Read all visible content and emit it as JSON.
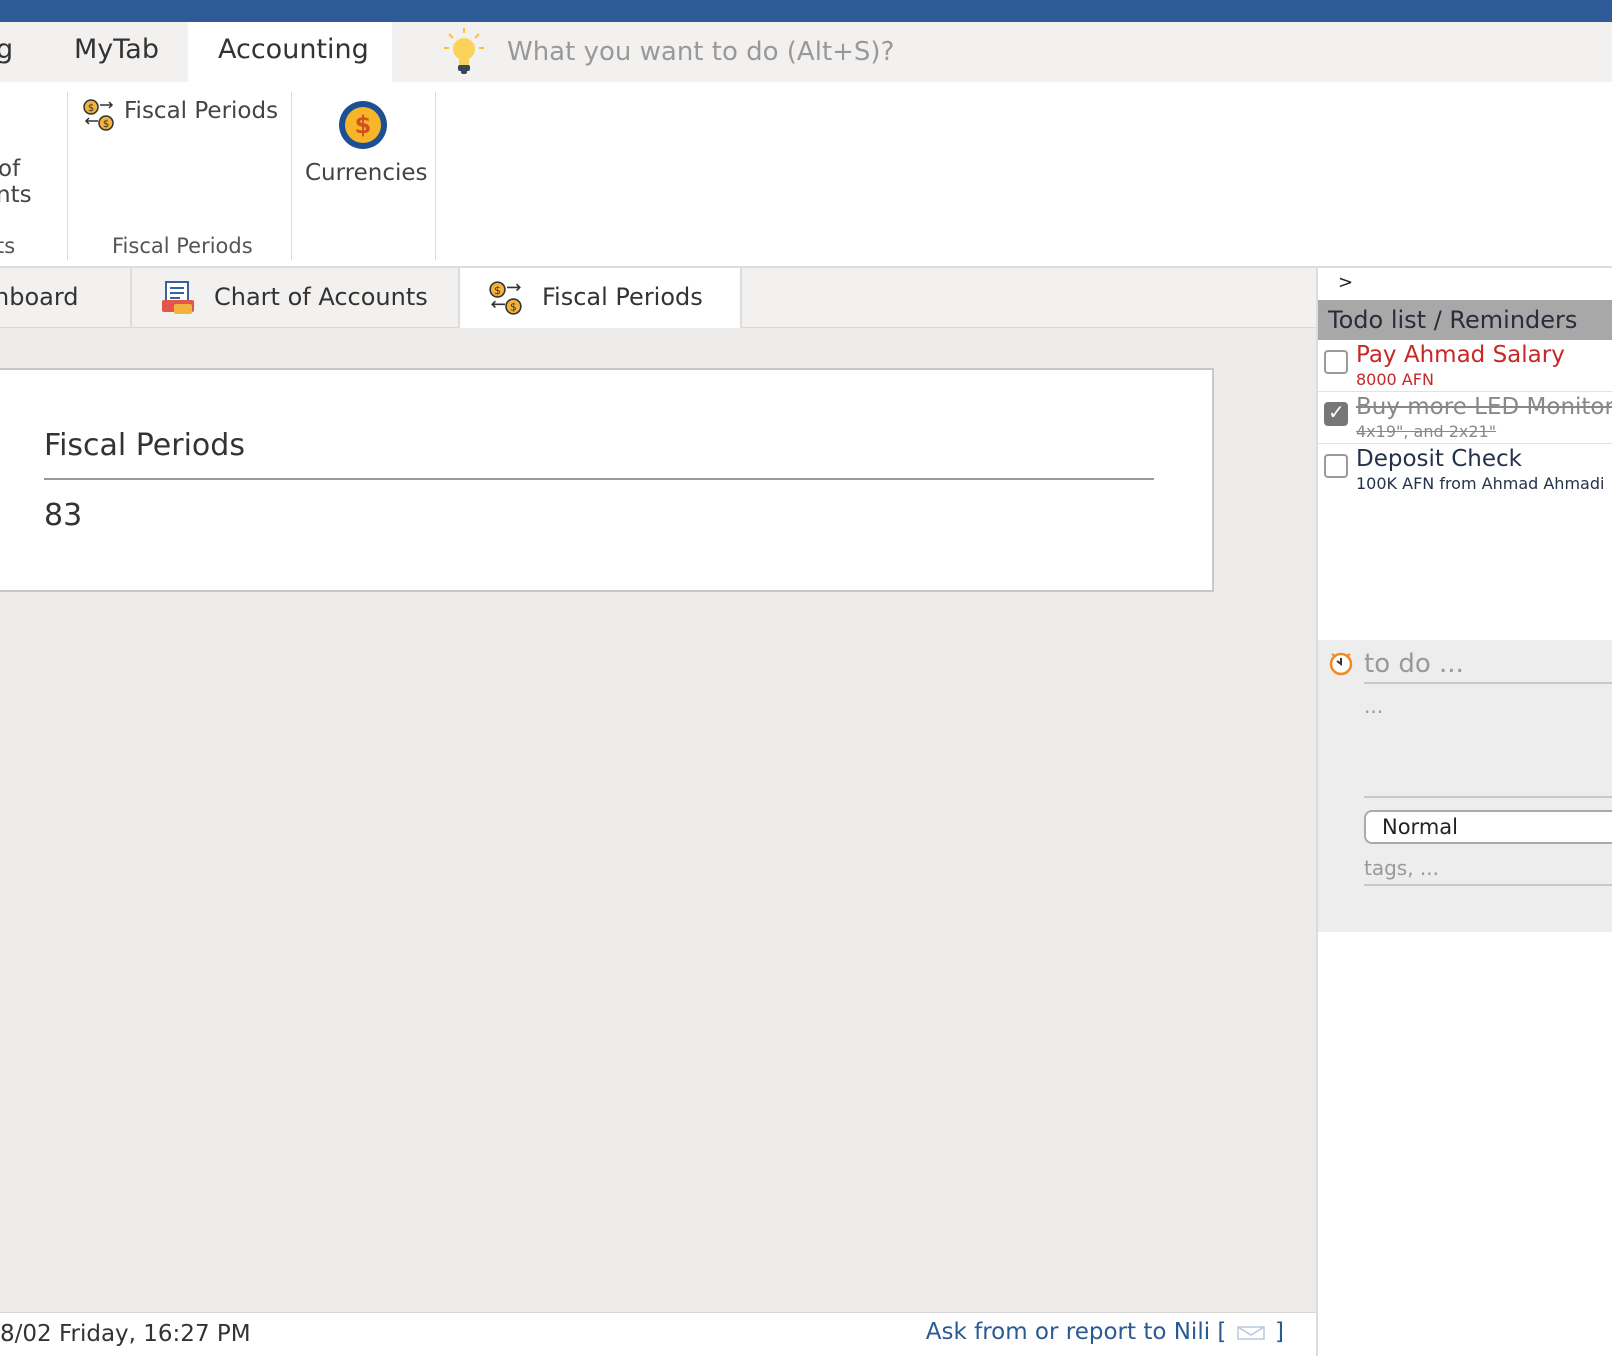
{
  "ribbon": {
    "tabs": [
      {
        "label": "g"
      },
      {
        "label": "MyTab"
      },
      {
        "label": "Accounting"
      }
    ],
    "search_placeholder": "What you want to do (Alt+S)?",
    "chart_btn_line1": "of",
    "chart_btn_line2": "nts",
    "chart_group_label": "ts",
    "fiscal_btn_label": "Fiscal Periods",
    "fiscal_group_label": "Fiscal Periods",
    "currencies_label": "Currencies"
  },
  "doc_tabs": [
    {
      "label": "hboard"
    },
    {
      "label": "Chart of Accounts"
    },
    {
      "label": "Fiscal Periods"
    }
  ],
  "card": {
    "title": "Fiscal Periods",
    "value": "83"
  },
  "status": {
    "date_text": "8/02 Friday,  16:27 PM",
    "ask_text": "Ask from or report to Nili [",
    "ask_close": "]"
  },
  "side": {
    "toggle": ">",
    "header": "Todo list / Reminders",
    "todos": [
      {
        "title": "Pay Ahmad Salary",
        "sub": "8000 AFN",
        "checked": false
      },
      {
        "title": "Buy more LED Monitors",
        "sub": "4x19\", and 2x21\"",
        "checked": true
      },
      {
        "title": "Deposit Check",
        "sub": "100K AFN from Ahmad Ahmadi",
        "checked": false
      }
    ],
    "new_todo": {
      "title_placeholder": "to do ...",
      "desc_placeholder": "...",
      "priority": "Normal",
      "tags_placeholder": "tags, ..."
    }
  },
  "colors": {
    "topbar": "#2e5a98",
    "todo_red": "#c62828",
    "link_blue": "#2a5a94"
  }
}
